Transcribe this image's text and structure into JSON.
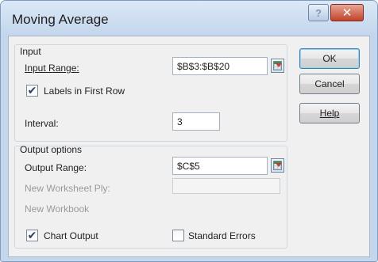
{
  "window": {
    "title": "Moving Average",
    "help_glyph": "?",
    "close_glyph": "✕"
  },
  "input": {
    "section_label": "Input",
    "range_label": "Input Range:",
    "range_value": "$B$3:$B$20",
    "labels_first_row_label": "Labels in First Row",
    "labels_first_row_checked": true,
    "interval_label": "Interval:",
    "interval_value": "3"
  },
  "output": {
    "section_label": "Output options",
    "range_label": "Output Range:",
    "range_value": "$C$5",
    "new_ply_label": "New Worksheet Ply:",
    "new_ply_value": "",
    "new_workbook_label": "New Workbook",
    "chart_output_label": "Chart Output",
    "chart_output_checked": true,
    "standard_errors_label": "Standard Errors",
    "standard_errors_checked": false
  },
  "buttons": {
    "ok": "OK",
    "cancel": "Cancel",
    "help": "Help"
  },
  "check_glyph": "✔",
  "colors": {
    "title_bar": "#c3d6ec",
    "client": "#f0f0f0",
    "close_button": "#c1432b",
    "checkmark": "#2d3f69"
  }
}
